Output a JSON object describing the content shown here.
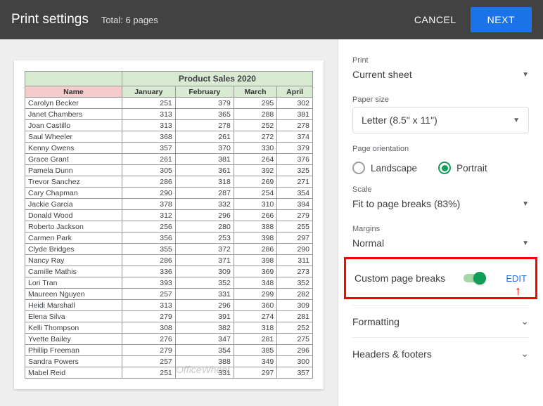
{
  "header": {
    "title": "Print settings",
    "subtitle": "Total: 6 pages",
    "cancel": "CANCEL",
    "next": "NEXT"
  },
  "preview": {
    "table_title": "Product Sales 2020",
    "columns": [
      "Name",
      "January",
      "February",
      "March",
      "April"
    ],
    "rows": [
      [
        "Carolyn Becker",
        "251",
        "379",
        "295",
        "302"
      ],
      [
        "Janet Chambers",
        "313",
        "365",
        "288",
        "381"
      ],
      [
        "Joan Castillo",
        "313",
        "278",
        "252",
        "278"
      ],
      [
        "Saul Wheeler",
        "368",
        "261",
        "272",
        "374"
      ],
      [
        "Kenny Owens",
        "357",
        "370",
        "330",
        "379"
      ],
      [
        "Grace Grant",
        "261",
        "381",
        "264",
        "376"
      ],
      [
        "Pamela Dunn",
        "305",
        "361",
        "392",
        "325"
      ],
      [
        "Trevor Sanchez",
        "286",
        "318",
        "269",
        "271"
      ],
      [
        "Cary Chapman",
        "290",
        "287",
        "254",
        "354"
      ],
      [
        "Jackie Garcia",
        "378",
        "332",
        "310",
        "394"
      ],
      [
        "Donald Wood",
        "312",
        "296",
        "266",
        "279"
      ],
      [
        "Roberto Jackson",
        "256",
        "280",
        "388",
        "255"
      ],
      [
        "Carmen Park",
        "356",
        "253",
        "398",
        "297"
      ],
      [
        "Clyde Bridges",
        "355",
        "372",
        "286",
        "290"
      ],
      [
        "Nancy Ray",
        "286",
        "371",
        "398",
        "311"
      ],
      [
        "Camille Mathis",
        "336",
        "309",
        "369",
        "273"
      ],
      [
        "Lori Tran",
        "393",
        "352",
        "348",
        "352"
      ],
      [
        "Maureen Nguyen",
        "257",
        "331",
        "299",
        "282"
      ],
      [
        "Heidi Marshall",
        "313",
        "296",
        "360",
        "309"
      ],
      [
        "Elena Silva",
        "279",
        "391",
        "274",
        "281"
      ],
      [
        "Kelli Thompson",
        "308",
        "382",
        "318",
        "252"
      ],
      [
        "Yvette Bailey",
        "276",
        "347",
        "281",
        "275"
      ],
      [
        "Phillip Freeman",
        "279",
        "354",
        "385",
        "296"
      ],
      [
        "Sandra Powers",
        "257",
        "388",
        "349",
        "300"
      ],
      [
        "Mabel Reid",
        "251",
        "331",
        "297",
        "357"
      ]
    ]
  },
  "sidebar": {
    "print_label": "Print",
    "print_value": "Current sheet",
    "paper_label": "Paper size",
    "paper_value": "Letter (8.5\" x 11\")",
    "orientation_label": "Page orientation",
    "orientation_landscape": "Landscape",
    "orientation_portrait": "Portrait",
    "scale_label": "Scale",
    "scale_value": "Fit to page breaks (83%)",
    "margins_label": "Margins",
    "margins_value": "Normal",
    "custom_breaks_label": "Custom page breaks",
    "edit_label": "EDIT",
    "formatting": "Formatting",
    "headers_footers": "Headers & footers"
  },
  "watermark": "OfficeWheel"
}
